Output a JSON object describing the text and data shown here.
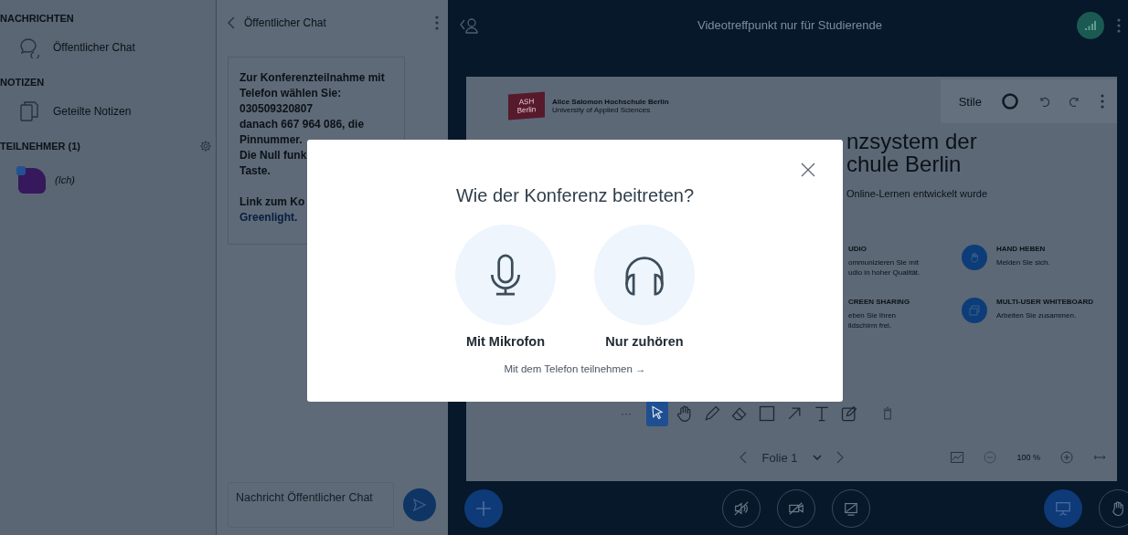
{
  "sidebar": {
    "sections": [
      {
        "kind": "messages",
        "title": "NACHRICHTEN",
        "items": [
          {
            "kind": "chat",
            "label": "Öffentlicher Chat"
          }
        ]
      },
      {
        "kind": "notes",
        "title": "NOTIZEN",
        "items": [
          {
            "kind": "notes",
            "label": "Geteilte Notizen"
          }
        ]
      },
      {
        "kind": "users",
        "title": "TEILNEHMER (1)",
        "items": [
          {
            "kind": "user",
            "label": "(Ich)"
          }
        ]
      }
    ]
  },
  "chat": {
    "title": "Öffentlicher Chat",
    "lines": [
      {
        "kind": "text",
        "text": "Zur Konferenzteilnahme mit"
      },
      {
        "kind": "text",
        "text": "Telefon wählen Sie:"
      },
      {
        "kind": "text",
        "text": "030509320807"
      },
      {
        "kind": "text",
        "text": "danach 667 964 086, die"
      },
      {
        "kind": "text",
        "text": "Pinnummer."
      },
      {
        "kind": "text",
        "text": "Die Null funk"
      },
      {
        "kind": "text",
        "text": "Taste."
      },
      {
        "kind": "gap"
      },
      {
        "kind": "text",
        "text": "Link zum Ko"
      },
      {
        "kind": "link",
        "text": "Greenlight."
      }
    ],
    "input": {
      "placeholder": "Nachricht Öffentlicher Chat"
    }
  },
  "meeting": {
    "title": "Videotreffpunkt nur für Studierende"
  },
  "slide": {
    "logo_badge": [
      "ASH",
      "Berlin"
    ],
    "logo_name": "Alice Salomon Hochschule Berlin",
    "logo_subtitle": "University of Applied Sciences",
    "heading_lines": [
      "nzsystem der",
      "chule Berlin"
    ],
    "subtitle": "Online-Lernen entwickelt wurde",
    "features": [
      {
        "kind": "plain",
        "title": "UDIO",
        "lines": [
          "ommunizieren Sie mit",
          "udio in hoher Qualität."
        ]
      },
      {
        "kind": "hand",
        "title": "HAND HEBEN",
        "lines": [
          "Melden Sie sich."
        ]
      },
      {
        "kind": "plain",
        "title": "CREEN SHARING",
        "lines": [
          "eben Sie Ihren",
          "ildschirm frei."
        ]
      },
      {
        "kind": "whiteboard",
        "title": "MULTI-USER WHITEBOARD",
        "lines": [
          "Arbeiten Sie zusammen."
        ]
      }
    ]
  },
  "style_toolbar": {
    "label": "Stile"
  },
  "tools": {
    "more": "···",
    "items": [
      {
        "kind": "pointer",
        "selected": true
      },
      {
        "kind": "hand",
        "selected": false
      },
      {
        "kind": "pencil",
        "selected": false
      },
      {
        "kind": "eraser",
        "selected": false
      },
      {
        "kind": "rectangle",
        "selected": false
      },
      {
        "kind": "arrow",
        "selected": false
      },
      {
        "kind": "text",
        "selected": false
      },
      {
        "kind": "note",
        "selected": false
      },
      {
        "kind": "trash",
        "selected": false
      }
    ]
  },
  "slide_nav": {
    "slide": "Folie 1",
    "zoom": "100 %"
  },
  "modal": {
    "title": "Wie der Konferenz beitreten?",
    "options": [
      {
        "kind": "microphone",
        "label": "Mit Mikrofon"
      },
      {
        "kind": "headphones",
        "label": "Nur zuhören"
      }
    ],
    "phone_link": "Mit dem Telefon teilnehmen →"
  }
}
